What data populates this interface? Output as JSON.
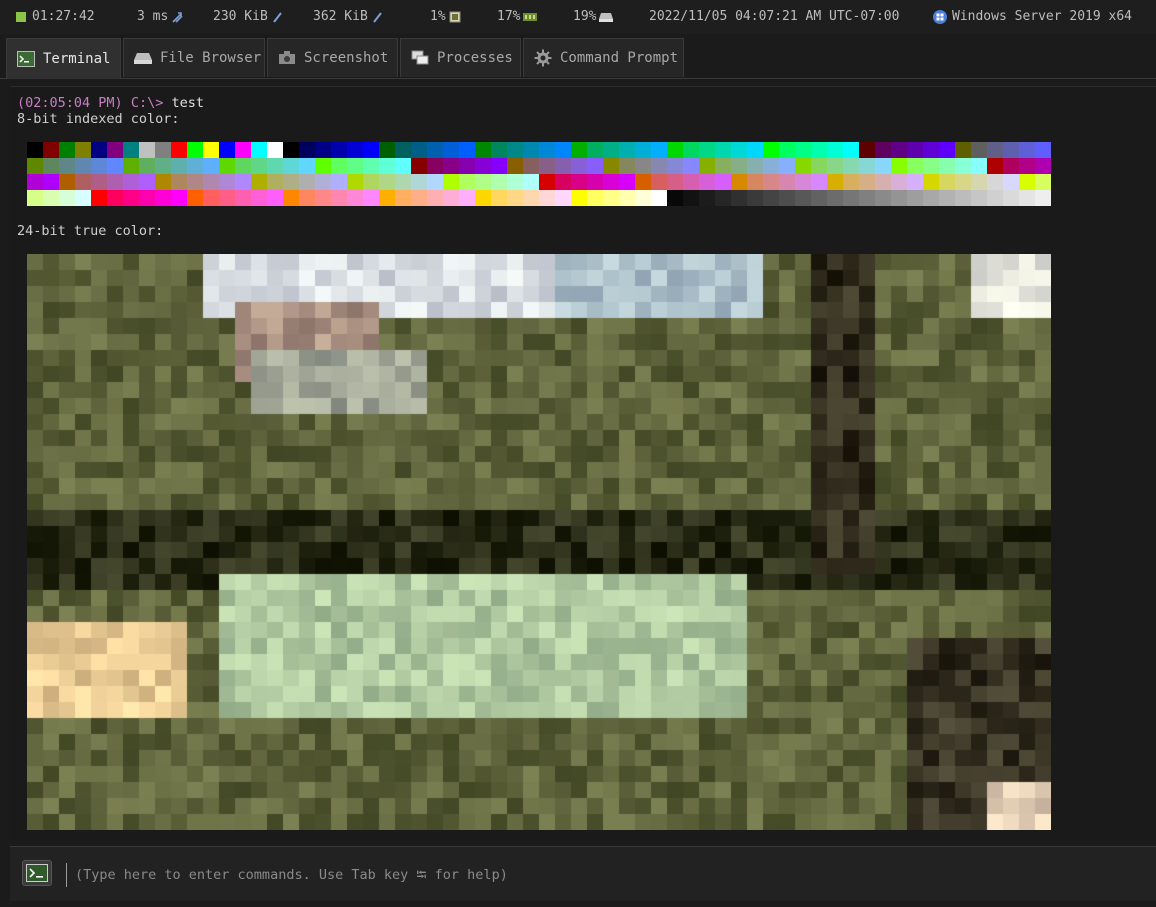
{
  "status": {
    "uptime": "01:27:42",
    "latency": "3 ms",
    "download": "230 KiB",
    "upload": "362 KiB",
    "cpu": "1%",
    "memory": "17%",
    "disk": "19%",
    "datetime": "2022/11/05 04:07:21 AM UTC-07:00",
    "os": "Windows Server 2019 x64",
    "colors": {
      "online": "#8cc34a"
    }
  },
  "tabs": [
    {
      "label": "Terminal",
      "icon": "terminal-icon",
      "active": true
    },
    {
      "label": "File Browser",
      "icon": "drive-icon",
      "active": false
    },
    {
      "label": "Screenshot",
      "icon": "camera-icon",
      "active": false
    },
    {
      "label": "Processes",
      "icon": "windows-icon",
      "active": false
    },
    {
      "label": "Command Prompt",
      "icon": "gear-icon",
      "active": false
    }
  ],
  "terminal": {
    "prompt_time": "(02:05:04 PM)",
    "prompt_path": "C:\\>",
    "command": "test",
    "heading_8bit": "8-bit indexed color:",
    "heading_24bit": "24-bit true color:"
  },
  "input": {
    "placeholder": "(Type here to enter commands. Use Tab key ⭾ for help)"
  }
}
